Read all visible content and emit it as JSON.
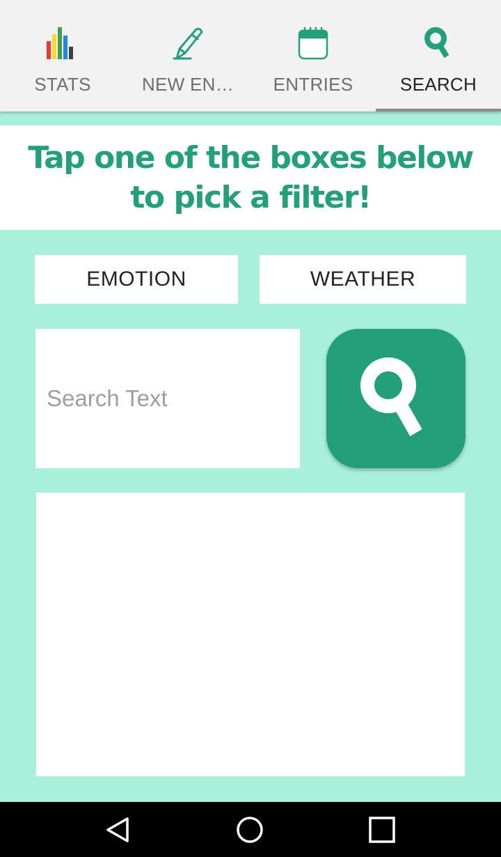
{
  "tabs": [
    {
      "label": "STATS",
      "icon": "bar-chart-icon",
      "active": false
    },
    {
      "label": "NEW EN…",
      "icon": "pen-icon",
      "active": false
    },
    {
      "label": "ENTRIES",
      "icon": "calendar-icon",
      "active": false
    },
    {
      "label": "SEARCH",
      "icon": "search-icon",
      "active": true
    }
  ],
  "banner": {
    "text": "Tap one of the boxes below to pick a filter!"
  },
  "filters": {
    "emotion_label": "EMOTION",
    "weather_label": "WEATHER"
  },
  "search": {
    "placeholder": "Search Text",
    "value": ""
  },
  "navbar": {
    "back_icon": "back-triangle-icon",
    "home_icon": "home-circle-icon",
    "recent_icon": "recent-apps-square-icon"
  },
  "colors": {
    "accent": "#23a07a",
    "background": "#a8f0da",
    "tabbar": "#f2f2f2"
  }
}
